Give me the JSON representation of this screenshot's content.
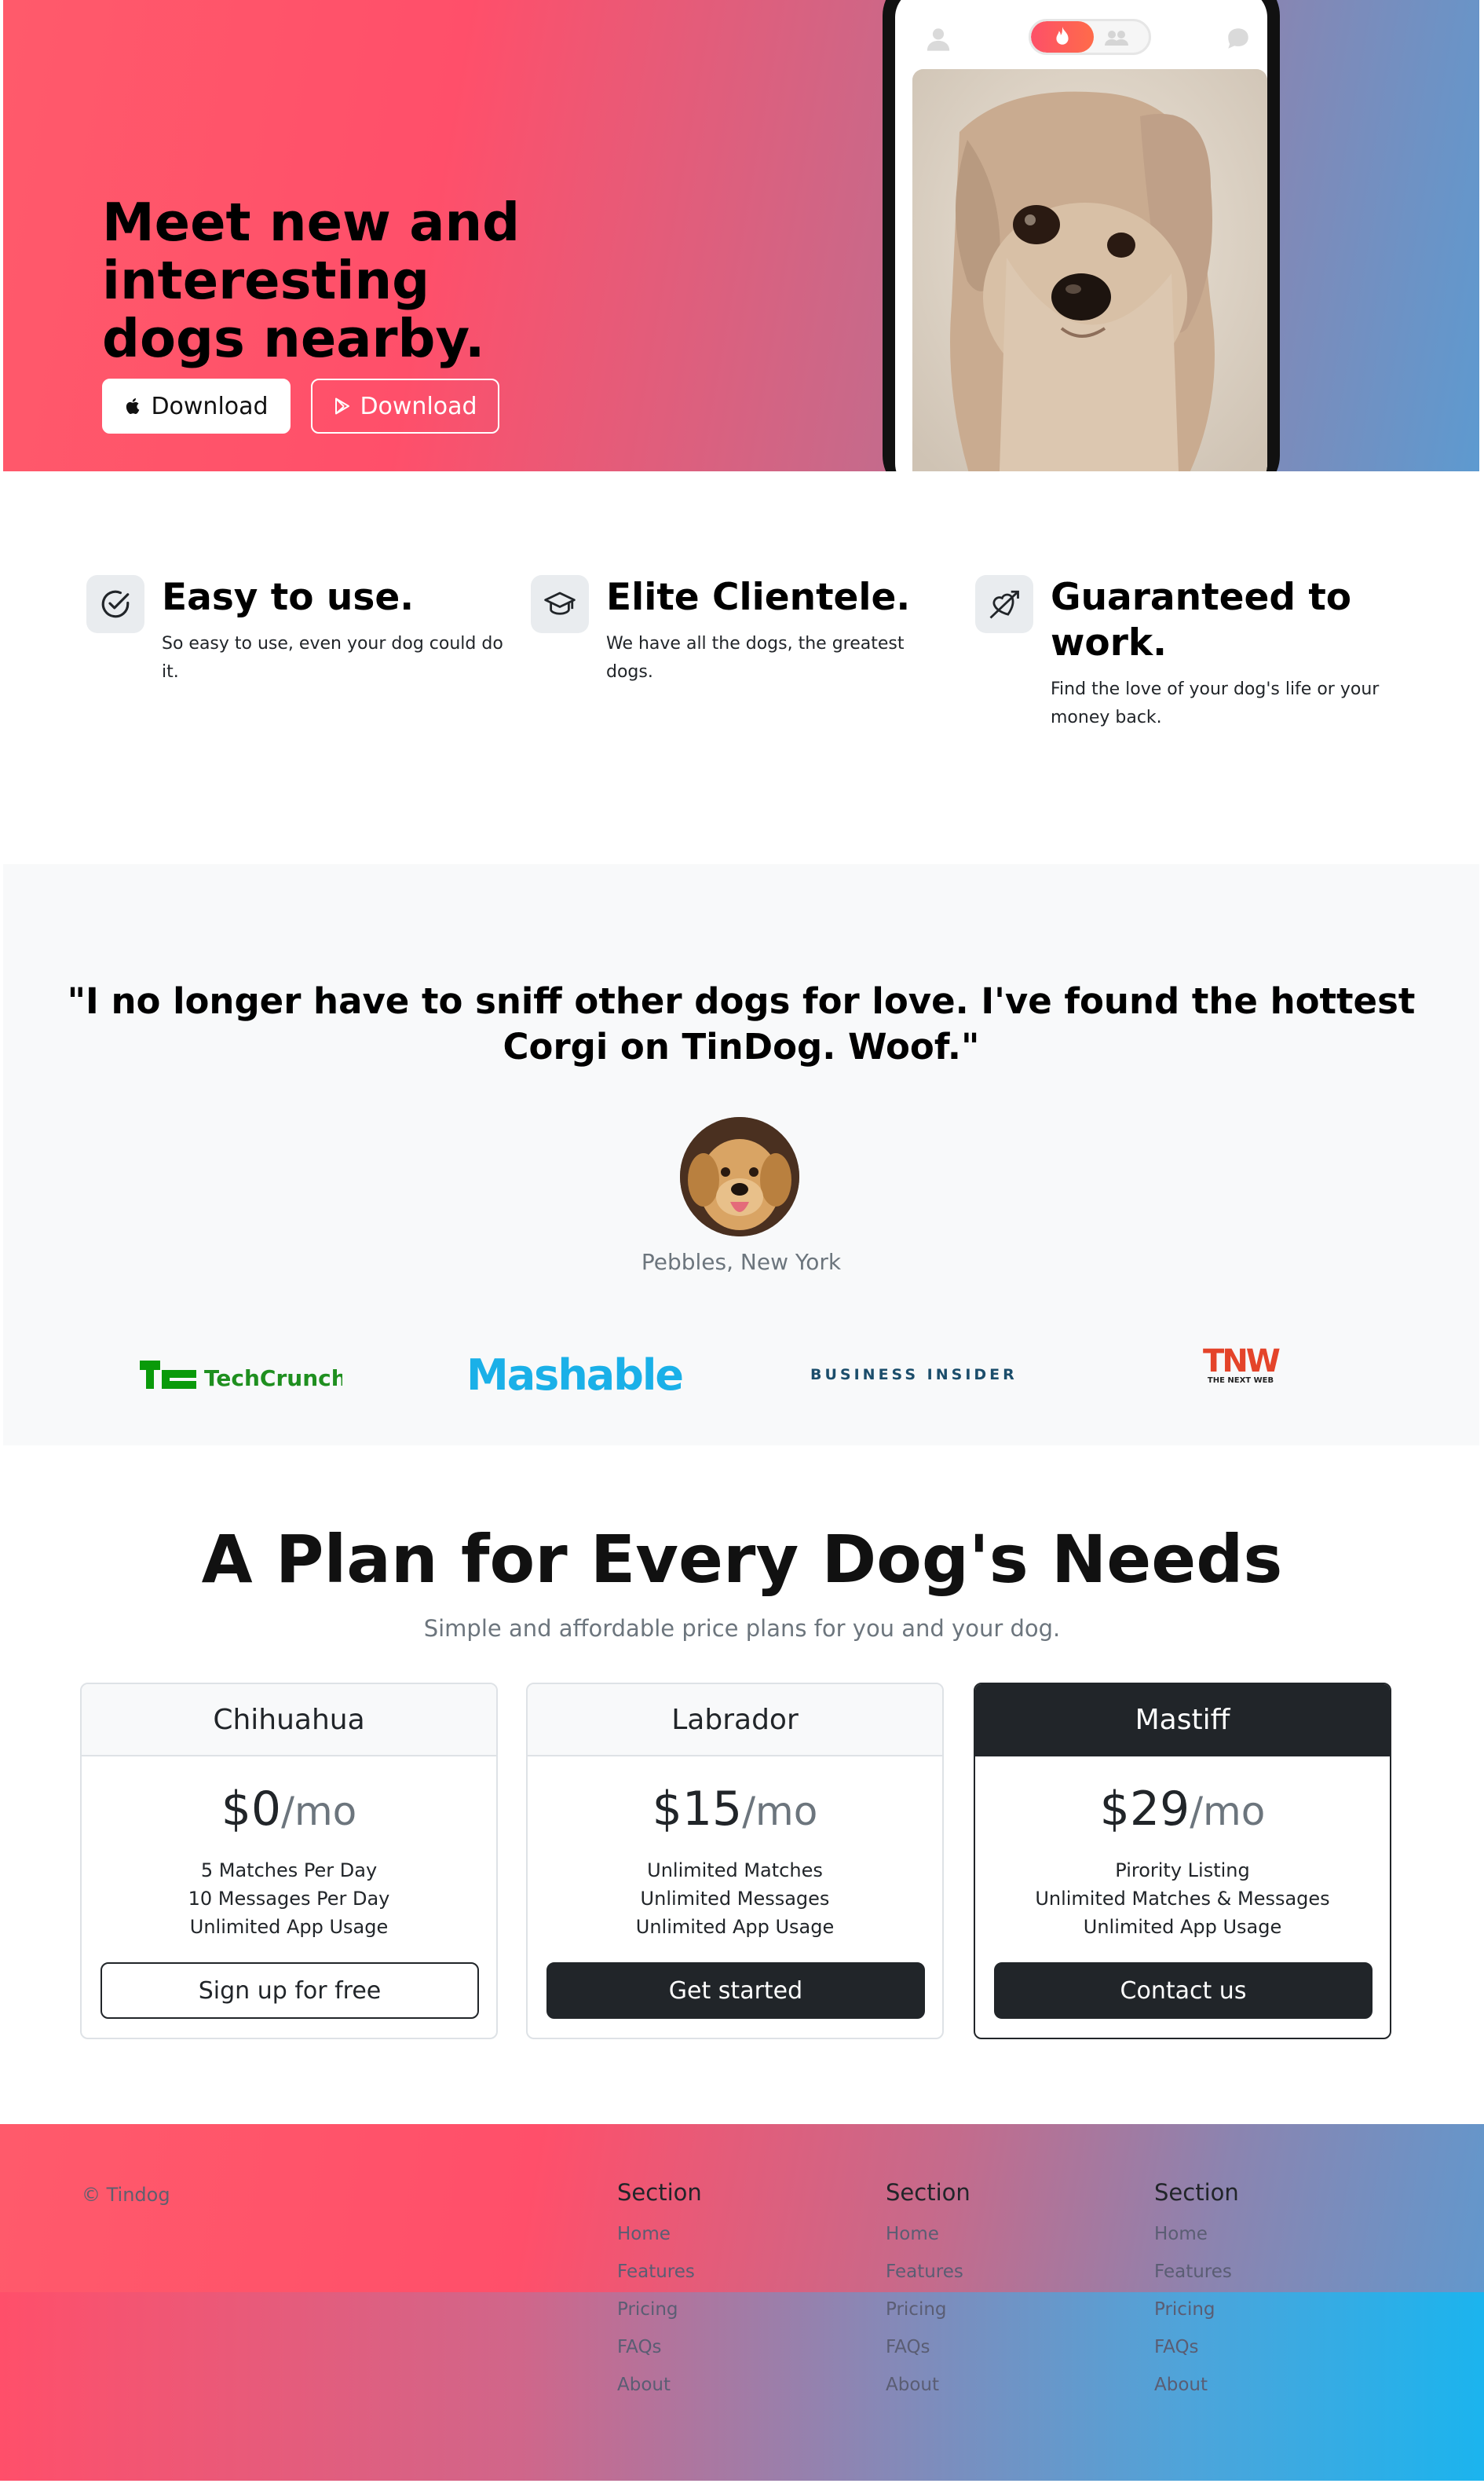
{
  "hero": {
    "title": "Meet new and interesting dogs nearby.",
    "download_apple": "Download",
    "download_play": "Download",
    "colors": {
      "gradient_start": "#ff5a6b",
      "gradient_end": "#5d9ad0"
    }
  },
  "features": [
    {
      "icon": "check-circle-icon",
      "title": "Easy to use.",
      "desc": "So easy to use, even your dog could do it."
    },
    {
      "icon": "graduation-cap-icon",
      "title": "Elite Clientele.",
      "desc": "We have all the dogs, the greatest dogs."
    },
    {
      "icon": "heart-arrow-icon",
      "title": "Guaranteed to work.",
      "desc": "Find the love of your dog's life or your money back."
    }
  ],
  "testimonial": {
    "quote": "\"I no longer have to sniff other dogs for love. I've found the hottest Corgi on TinDog. Woof.\"",
    "author": "Pebbles, New York"
  },
  "press": [
    "TechCrunch",
    "Mashable",
    "BUSINESS INSIDER",
    "TNW",
    "THE NEXT WEB"
  ],
  "pricing": {
    "title": "A Plan for Every Dog's Needs",
    "subtitle": "Simple and affordable price plans for you and your dog.",
    "plans": [
      {
        "name": "Chihuahua",
        "price": "$0",
        "period": "/mo",
        "features": [
          "5 Matches Per Day",
          "10 Messages Per Day",
          "Unlimited App Usage"
        ],
        "button": "Sign up for free"
      },
      {
        "name": "Labrador",
        "price": "$15",
        "period": "/mo",
        "features": [
          "Unlimited Matches",
          "Unlimited Messages",
          "Unlimited App Usage"
        ],
        "button": "Get started"
      },
      {
        "name": "Mastiff",
        "price": "$29",
        "period": "/mo",
        "features": [
          "Pirority Listing",
          "Unlimited Matches & Messages",
          "Unlimited App Usage"
        ],
        "button": "Contact us"
      }
    ]
  },
  "footer": {
    "copyright": "© Tindog",
    "columns": [
      {
        "heading": "Section",
        "links": [
          "Home",
          "Features",
          "Pricing",
          "FAQs",
          "About"
        ]
      },
      {
        "heading": "Section",
        "links": [
          "Home",
          "Features",
          "Pricing",
          "FAQs",
          "About"
        ]
      },
      {
        "heading": "Section",
        "links": [
          "Home",
          "Features",
          "Pricing",
          "FAQs",
          "About"
        ]
      }
    ]
  }
}
